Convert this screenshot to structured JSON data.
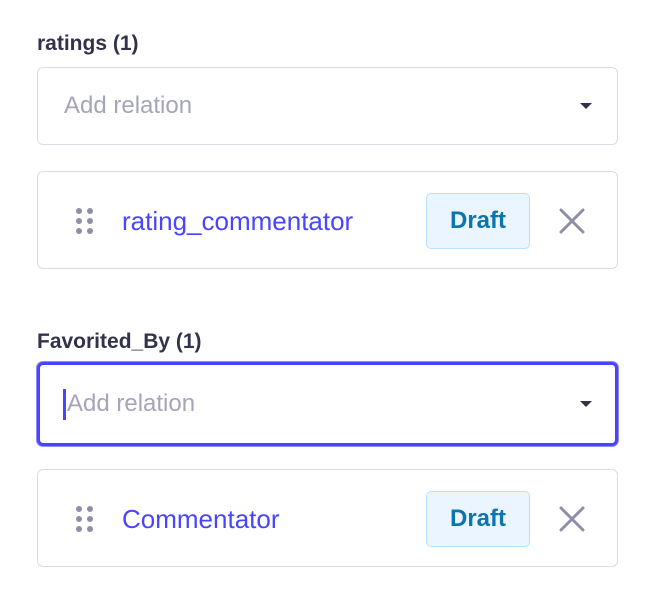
{
  "fields": [
    {
      "label": "ratings (1)",
      "placeholder": "Add relation",
      "relations": [
        {
          "name": "rating_commentator",
          "status": "Draft"
        }
      ]
    },
    {
      "label": "Favorited_By (1)",
      "placeholder": "Add relation",
      "relations": [
        {
          "name": "Commentator",
          "status": "Draft"
        }
      ]
    }
  ],
  "icons": {
    "dropdown": "chevron-down-icon",
    "drag": "drag-handle-icon",
    "remove": "close-icon"
  },
  "colors": {
    "accent": "#4945ff",
    "label": "#32324d",
    "placeholder": "#a5a5ba",
    "badge_text": "#0c75af",
    "badge_bg": "#eaf5ff",
    "border": "#dcdce4",
    "icon": "#8e8ea9"
  }
}
